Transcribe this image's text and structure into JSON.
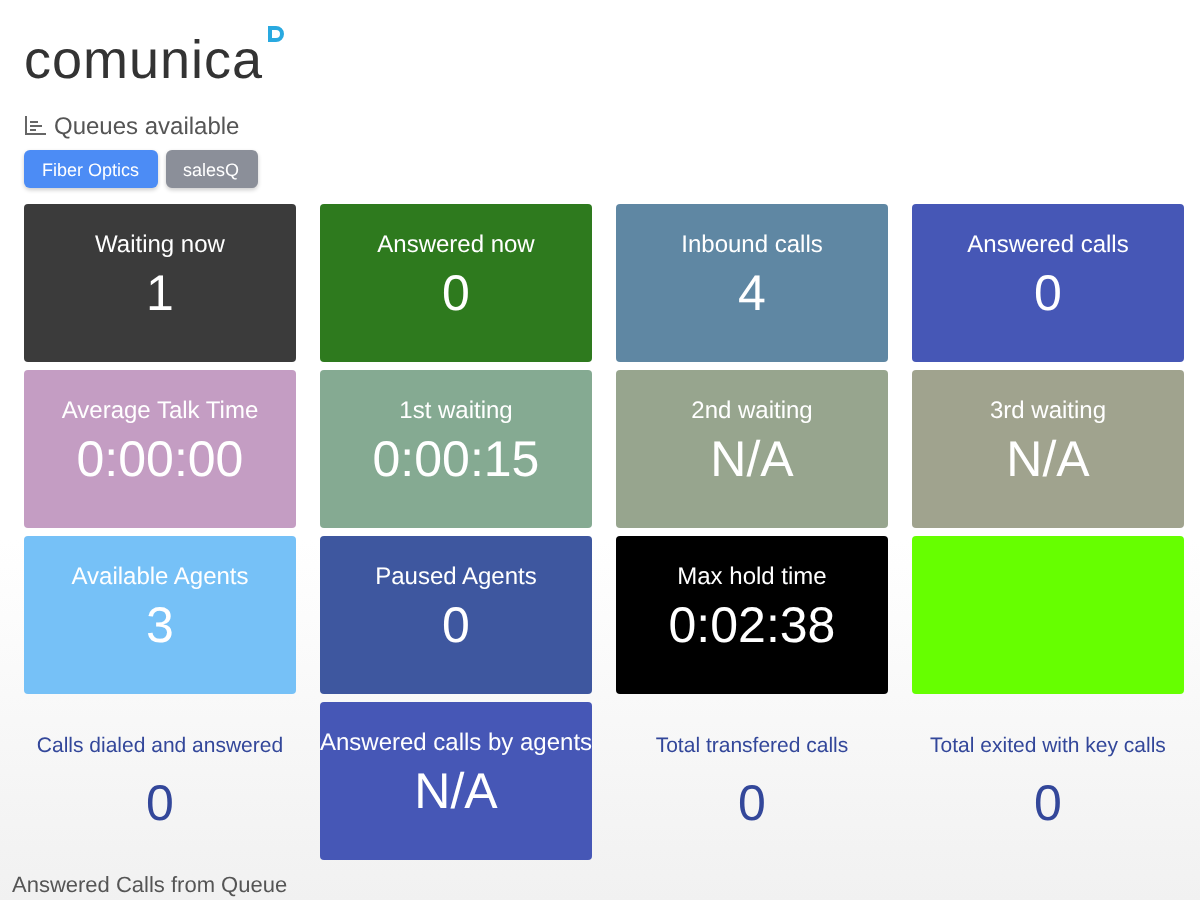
{
  "logo": {
    "text": "comunica"
  },
  "queues": {
    "title": "Queues available",
    "buttons": [
      {
        "label": "Fiber Optics",
        "selected": true
      },
      {
        "label": "salesQ",
        "selected": false
      }
    ]
  },
  "tiles": [
    {
      "kind": "filled",
      "label": "Waiting now",
      "value": "1",
      "color": "#3b3b3b"
    },
    {
      "kind": "filled",
      "label": "Answered now",
      "value": "0",
      "color": "#2e7a1e"
    },
    {
      "kind": "filled",
      "label": "Inbound calls",
      "value": "4",
      "color": "#5f87a3"
    },
    {
      "kind": "filled",
      "label": "Answered calls",
      "value": "0",
      "color": "#4657b6"
    },
    {
      "kind": "filled",
      "label": "Average Talk Time",
      "value": "0:00:00",
      "color": "#c49dc3"
    },
    {
      "kind": "filled",
      "label": "1st waiting",
      "value": "0:00:15",
      "color": "#85aa92"
    },
    {
      "kind": "filled",
      "label": "2nd waiting",
      "value": "N/A",
      "color": "#97a58e"
    },
    {
      "kind": "filled",
      "label": "3rd waiting",
      "value": "N/A",
      "color": "#a0a38e"
    },
    {
      "kind": "filled",
      "label": "Available Agents",
      "value": "3",
      "color": "#76c1f7"
    },
    {
      "kind": "filled",
      "label": "Paused Agents",
      "value": "0",
      "color": "#3e579f"
    },
    {
      "kind": "filled",
      "label": "Max hold time",
      "value": "0:02:38",
      "color": "#000000"
    },
    {
      "kind": "empty",
      "color": "#66ff00"
    },
    {
      "kind": "plain",
      "label": "Calls dialed and answered",
      "value": "0"
    },
    {
      "kind": "filled",
      "label": "Answered calls by agents",
      "value": "N/A",
      "color": "#4657b6"
    },
    {
      "kind": "plain",
      "label": "Total transfered calls",
      "value": "0"
    },
    {
      "kind": "plain",
      "label": "Total exited with key calls",
      "value": "0"
    }
  ],
  "footer": {
    "title": "Answered Calls from Queue"
  }
}
